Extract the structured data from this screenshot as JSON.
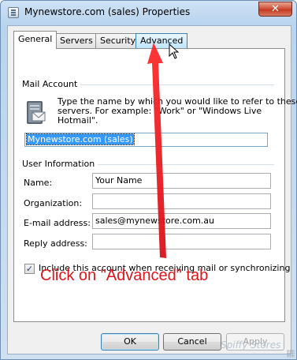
{
  "window": {
    "title": "Mynewstore.com (sales) Properties",
    "close_glyph": "✕"
  },
  "tabs": [
    {
      "label": "General",
      "state": "active"
    },
    {
      "label": "Servers",
      "state": "normal"
    },
    {
      "label": "Security",
      "state": "normal"
    },
    {
      "label": "Advanced",
      "state": "hover"
    }
  ],
  "mail_account": {
    "group_title": "Mail Account",
    "description_lines": [
      "Type the name by which you would like to refer to these",
      "servers.  For example: \"Work\" or \"Windows Live",
      "Hotmail\"."
    ],
    "account_name": "Mynewstore.com (sales)"
  },
  "user_information": {
    "group_title": "User Information",
    "fields": [
      {
        "label": "Name:",
        "value": "Your Name"
      },
      {
        "label": "Organization:",
        "value": ""
      },
      {
        "label": "E-mail address:",
        "value": "sales@mynewstore.com.au"
      },
      {
        "label": "Reply address:",
        "value": ""
      }
    ]
  },
  "include_account": {
    "checked": true,
    "check_glyph": "✓",
    "label": "Include this account when receiving mail or synchronizing"
  },
  "buttons": {
    "ok": "OK",
    "cancel": "Cancel",
    "apply": "Apply"
  },
  "annotation": {
    "caption": "Click on \"Advanced\" tab",
    "arrow_color": "#e0151b"
  },
  "watermark": "Spiffy Stores"
}
